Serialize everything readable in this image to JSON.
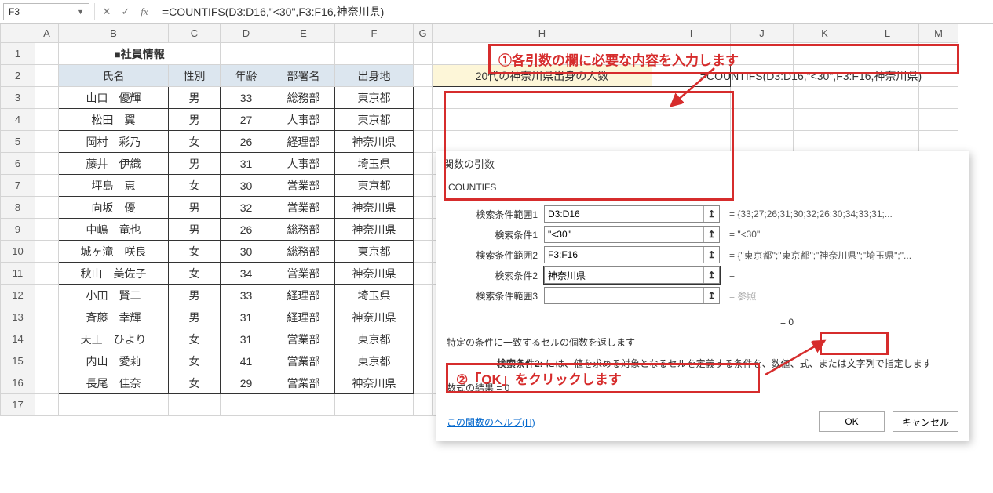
{
  "namebox": "F3",
  "formula_bar": "=COUNTIFS(D3:D16,\"<30\",F3:F16,神奈川県)",
  "sheet_title": "■社員情報",
  "col_headers": [
    "A",
    "B",
    "C",
    "D",
    "E",
    "F",
    "G",
    "H",
    "I",
    "J",
    "K",
    "L",
    "M"
  ],
  "row_headers": [
    "1",
    "2",
    "3",
    "4",
    "5",
    "6",
    "7",
    "8",
    "9",
    "10",
    "11",
    "12",
    "13",
    "14",
    "15",
    "16",
    "17"
  ],
  "table_headers": {
    "name": "氏名",
    "gender": "性別",
    "age": "年齢",
    "dept": "部署名",
    "origin": "出身地"
  },
  "rows": [
    {
      "name": "山口　優輝",
      "gender": "男",
      "age": "33",
      "dept": "総務部",
      "origin": "東京都"
    },
    {
      "name": "松田　翼",
      "gender": "男",
      "age": "27",
      "dept": "人事部",
      "origin": "東京都"
    },
    {
      "name": "岡村　彩乃",
      "gender": "女",
      "age": "26",
      "dept": "経理部",
      "origin": "神奈川県"
    },
    {
      "name": "藤井　伊織",
      "gender": "男",
      "age": "31",
      "dept": "人事部",
      "origin": "埼玉県"
    },
    {
      "name": "坪島　恵",
      "gender": "女",
      "age": "30",
      "dept": "営業部",
      "origin": "東京都"
    },
    {
      "name": "向坂　優",
      "gender": "男",
      "age": "32",
      "dept": "営業部",
      "origin": "神奈川県"
    },
    {
      "name": "中嶋　竜也",
      "gender": "男",
      "age": "26",
      "dept": "総務部",
      "origin": "神奈川県"
    },
    {
      "name": "城ヶ滝　咲良",
      "gender": "女",
      "age": "30",
      "dept": "総務部",
      "origin": "東京都"
    },
    {
      "name": "秋山　美佐子",
      "gender": "女",
      "age": "34",
      "dept": "営業部",
      "origin": "神奈川県"
    },
    {
      "name": "小田　賢二",
      "gender": "男",
      "age": "33",
      "dept": "経理部",
      "origin": "埼玉県"
    },
    {
      "name": "斉藤　幸輝",
      "gender": "男",
      "age": "31",
      "dept": "経理部",
      "origin": "神奈川県"
    },
    {
      "name": "天王　ひより",
      "gender": "女",
      "age": "31",
      "dept": "営業部",
      "origin": "東京都"
    },
    {
      "name": "内山　愛莉",
      "gender": "女",
      "age": "41",
      "dept": "営業部",
      "origin": "東京都"
    },
    {
      "name": "長尾　佳奈",
      "gender": "女",
      "age": "29",
      "dept": "営業部",
      "origin": "神奈川県"
    }
  ],
  "question_label": "20代の神奈川県出身の人数",
  "question_formula": "=COUNTIFS(D3:D16,\"<30\",F3:F16,神奈川県)",
  "dialog": {
    "title": "関数の引数",
    "fn_name": "COUNTIFS",
    "args": [
      {
        "label": "検索条件範囲1",
        "value": "D3:D16",
        "result": "=  {33;27;26;31;30;32;26;30;34;33;31;..."
      },
      {
        "label": "検索条件1",
        "value": "\"<30\"",
        "result": "=  \"<30\""
      },
      {
        "label": "検索条件範囲2",
        "value": "F3:F16",
        "result": "=  {\"東京都\";\"東京都\";\"神奈川県\";\"埼玉県\";\"..."
      },
      {
        "label": "検索条件2",
        "value": "神奈川県",
        "result": "=",
        "focus": true
      },
      {
        "label": "検索条件範囲3",
        "value": "",
        "result": "=  参照",
        "muted": true
      }
    ],
    "final_eq": "=  0",
    "desc1": "特定の条件に一致するセルの個数を返します",
    "desc2_lead": "検索条件2:",
    "desc2_body": "  には、値を求める対象となるセルを定義する条件を、数値、式、または文字列で指定します",
    "result_label": "数式の結果 =  0",
    "help": "この関数のヘルプ(H)",
    "ok": "OK",
    "cancel": "キャンセル"
  },
  "callouts": {
    "c1": "①各引数の欄に必要な内容を入力します",
    "c2": "②「OK」をクリックします"
  }
}
